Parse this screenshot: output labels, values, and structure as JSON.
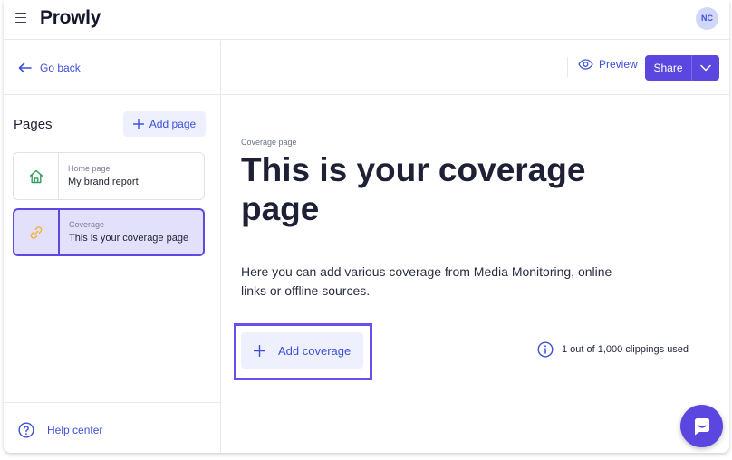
{
  "app": {
    "logo": "Prowly"
  },
  "user": {
    "initials": "NC"
  },
  "sidebar": {
    "back_label": "Go back",
    "pages_title": "Pages",
    "add_page_label": "Add page",
    "pages": [
      {
        "kind": "Home page",
        "name": "My brand report",
        "icon": "home-icon",
        "active": false
      },
      {
        "kind": "Coverage",
        "name": "This is your coverage page",
        "icon": "link-icon",
        "active": true
      }
    ],
    "help_label": "Help center"
  },
  "header": {
    "preview_label": "Preview",
    "share_label": "Share"
  },
  "main": {
    "crumb": "Coverage page",
    "heading": "This is your coverage page",
    "description": "Here you can add various coverage from Media Monitoring, online links or offline sources.",
    "add_coverage_label": "Add coverage",
    "usage": "1 out of 1,000 clippings used"
  },
  "colors": {
    "accent": "#5b47e0",
    "link": "#3e4fd8",
    "active_card_bg": "#e3e0fb",
    "highlight": "#6a4ff0",
    "home_icon": "#2f9e5a",
    "link_icon": "#f2b33d"
  }
}
